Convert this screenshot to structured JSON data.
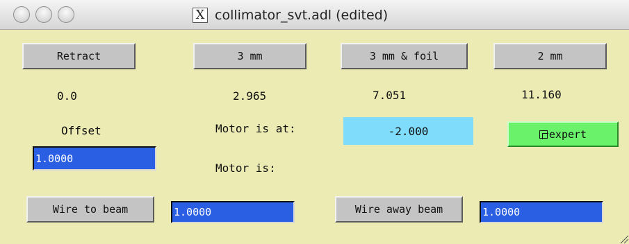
{
  "window": {
    "title": "collimator_svt.adl (edited)"
  },
  "buttons": {
    "retract": "Retract",
    "mm3": "3 mm",
    "mm3_foil": "3 mm & foil",
    "mm2": "2 mm",
    "wire_to_beam": "Wire to beam",
    "wire_away_beam": "Wire away beam",
    "expert": "expert"
  },
  "positions": {
    "retract": "0.0",
    "mm3": "2.965",
    "mm3_foil": "7.051",
    "mm2": "11.160"
  },
  "labels": {
    "offset": "Offset",
    "motor_at": "Motor is at:",
    "motor_is": "Motor is:"
  },
  "motor_readback": "-2.000",
  "entries": {
    "offset": "1.0000",
    "wire_to_beam": "1.0000",
    "wire_away_beam": "1.0000"
  },
  "colors": {
    "background": "#ecebb3",
    "entry": "#2a5fe3",
    "readback": "#7fdcfa",
    "expert": "#6af36a",
    "button": "#c4c4c4"
  }
}
